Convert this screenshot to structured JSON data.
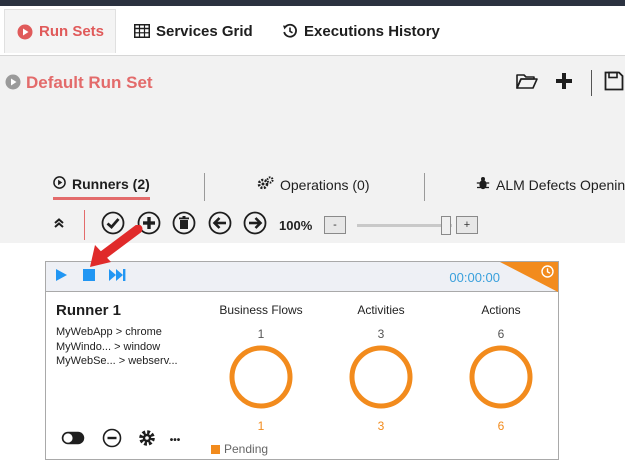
{
  "main_tabs": [
    {
      "label": "Run Sets",
      "icon": "play-circle-icon",
      "active": true
    },
    {
      "label": "Services Grid",
      "icon": "grid-icon",
      "active": false
    },
    {
      "label": "Executions History",
      "icon": "history-icon",
      "active": false
    }
  ],
  "runset": {
    "title": "Default Run Set"
  },
  "subtabs": [
    {
      "label": "Runners (2)",
      "icon": "play-circle-icon",
      "active": true
    },
    {
      "label": "Operations (0)",
      "icon": "gears-icon",
      "active": false
    },
    {
      "label": "ALM Defects Openin",
      "icon": "bug-icon",
      "active": false
    }
  ],
  "toolbar": {
    "zoom_label": "100%",
    "zoom_minus": "-",
    "zoom_plus": "+",
    "zoom_level_percent": 100
  },
  "runner": {
    "name": "Runner 1",
    "timer": "00:00:00",
    "targets": [
      "MyWebApp > chrome",
      "MyWindo... > window",
      "MyWebSe... > webserv..."
    ],
    "metrics": [
      {
        "title": "Business Flows",
        "total": "1",
        "count": "1"
      },
      {
        "title": "Activities",
        "total": "3",
        "count": "3"
      },
      {
        "title": "Actions",
        "total": "6",
        "count": "6"
      }
    ],
    "more_label": "•••",
    "legend": "Pending"
  },
  "colors": {
    "accent": "#e36b6b",
    "pending": "#f28b1d",
    "timer": "#3aa0dc",
    "control": "#2196f3"
  }
}
